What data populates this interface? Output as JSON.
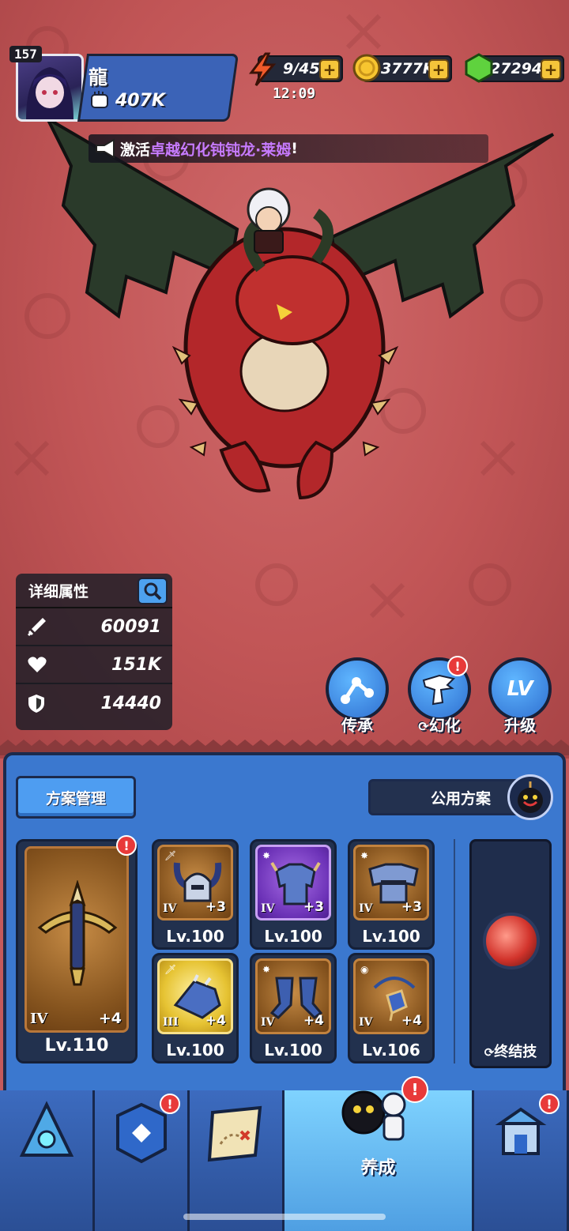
{
  "player": {
    "level": "157",
    "name": "龍",
    "power": "407K"
  },
  "resources": {
    "energy": "9/45",
    "energy_timer": "12:09",
    "gold": "3777K",
    "gems": "27294",
    "plus": "+"
  },
  "announcement": {
    "prefix": "激活",
    "highlight": "卓越幻化钝钝龙·莱姆",
    "suffix": "!"
  },
  "stats": {
    "title": "详细属性",
    "attack": "60091",
    "health": "151K",
    "defense": "14440"
  },
  "actions": {
    "inherit": "传承",
    "transform": "幻化",
    "upgrade": "升级",
    "upgrade_icon_text": "LV",
    "transform_badge": "!"
  },
  "plan": {
    "manage": "方案管理",
    "public": "公用方案"
  },
  "main_weapon": {
    "tier": "IV",
    "plus": "+4",
    "level": "Lv.110",
    "badge": "!"
  },
  "equipment": [
    {
      "tier": "IV",
      "plus": "+3",
      "level": "Lv.100",
      "icon": "helmet-icon"
    },
    {
      "tier": "IV",
      "plus": "+3",
      "level": "Lv.100",
      "icon": "armor-icon"
    },
    {
      "tier": "IV",
      "plus": "+3",
      "level": "Lv.100",
      "icon": "shoulder-icon"
    },
    {
      "tier": "III",
      "plus": "+4",
      "level": "Lv.100",
      "icon": "gauntlet-icon"
    },
    {
      "tier": "IV",
      "plus": "+4",
      "level": "Lv.100",
      "icon": "greaves-icon"
    },
    {
      "tier": "IV",
      "plus": "+4",
      "level": "Lv.106",
      "icon": "amulet-icon"
    }
  ],
  "ultimate": {
    "label": "终结技"
  },
  "nav": {
    "items": [
      {
        "label": "",
        "icon": "crystal-icon",
        "badge": ""
      },
      {
        "label": "",
        "icon": "card-icon",
        "badge": "!"
      },
      {
        "label": "",
        "icon": "map-icon",
        "badge": ""
      },
      {
        "label": "养成",
        "icon": "character-icon",
        "badge": "!"
      },
      {
        "label": "",
        "icon": "shop-icon",
        "badge": "!"
      }
    ]
  },
  "colors": {
    "background": "#c45a5c",
    "panel": "#3b78cf",
    "accent_purple": "#c77bff",
    "badge_red": "#e83a3a"
  }
}
